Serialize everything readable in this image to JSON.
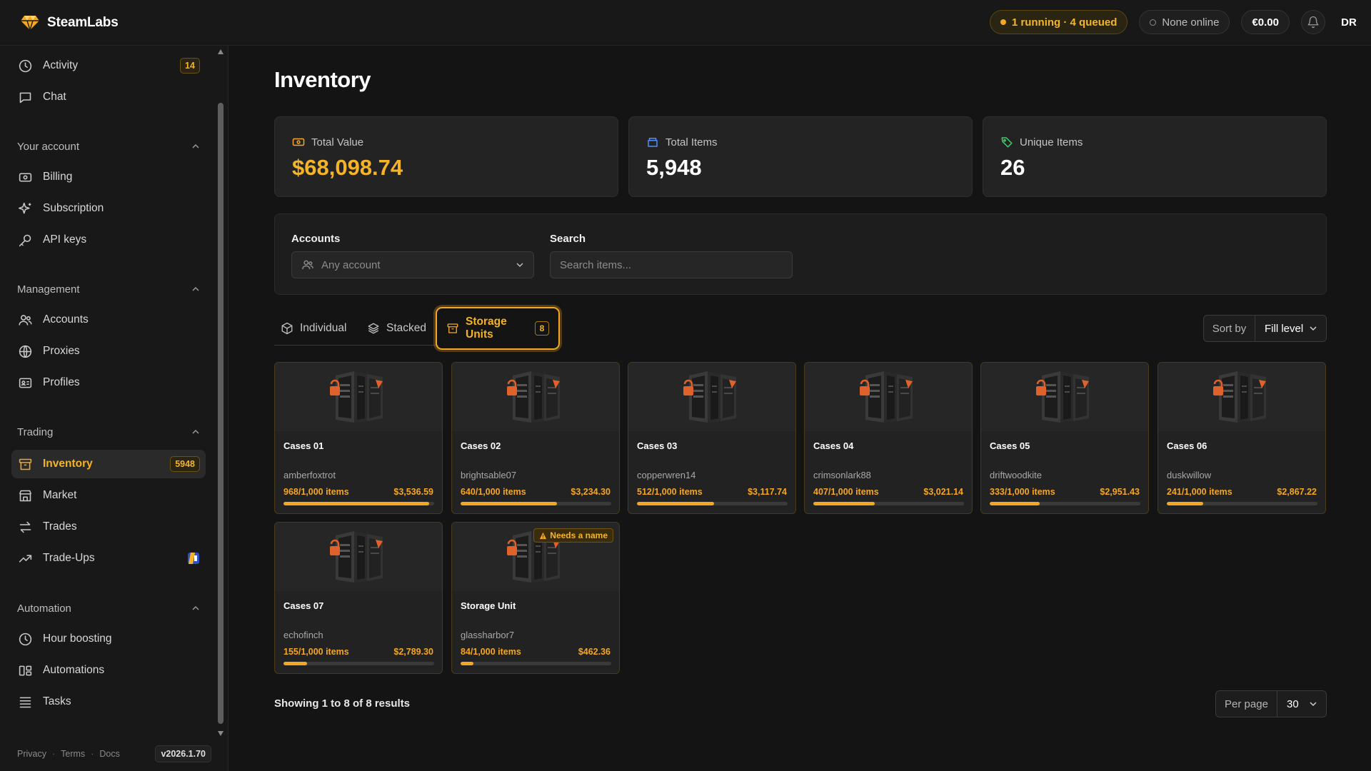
{
  "app": {
    "name": "SteamLabs"
  },
  "topbar": {
    "status": "1 running · 4 queued",
    "online": "None online",
    "balance": "€0.00",
    "avatar": "DR"
  },
  "sidebar": {
    "items": [
      {
        "label": "Activity",
        "icon": "clock-icon",
        "badge": "14"
      },
      {
        "label": "Chat",
        "icon": "chat-icon"
      }
    ],
    "sections": [
      {
        "title": "Your account",
        "items": [
          {
            "label": "Billing",
            "icon": "billing-icon"
          },
          {
            "label": "Subscription",
            "icon": "sparkle-icon"
          },
          {
            "label": "API keys",
            "icon": "key-icon"
          }
        ]
      },
      {
        "title": "Management",
        "items": [
          {
            "label": "Accounts",
            "icon": "users-icon"
          },
          {
            "label": "Proxies",
            "icon": "globe-icon"
          },
          {
            "label": "Profiles",
            "icon": "id-card-icon"
          }
        ]
      },
      {
        "title": "Trading",
        "items": [
          {
            "label": "Inventory",
            "icon": "archive-icon",
            "badge": "5948",
            "active": true
          },
          {
            "label": "Market",
            "icon": "store-icon"
          },
          {
            "label": "Trades",
            "icon": "swap-icon"
          },
          {
            "label": "Trade-Ups",
            "icon": "trend-up-icon"
          }
        ]
      },
      {
        "title": "Automation",
        "items": [
          {
            "label": "Hour boosting",
            "icon": "clock-icon"
          },
          {
            "label": "Automations",
            "icon": "automation-icon"
          },
          {
            "label": "Tasks",
            "icon": "list-icon"
          }
        ]
      }
    ],
    "footer": {
      "privacy": "Privacy",
      "terms": "Terms",
      "docs": "Docs",
      "version": "v2026.1.70"
    }
  },
  "main": {
    "title": "Inventory",
    "stats": {
      "total_value": {
        "label": "Total Value",
        "value": "$68,098.74"
      },
      "total_items": {
        "label": "Total Items",
        "value": "5,948"
      },
      "unique_items": {
        "label": "Unique Items",
        "value": "26"
      }
    },
    "filters": {
      "accounts_label": "Accounts",
      "accounts_value": "Any account",
      "search_label": "Search",
      "search_placeholder": "Search items..."
    },
    "tabs": {
      "individual": "Individual",
      "stacked": "Stacked",
      "storage": "Storage Units",
      "storage_count": "8"
    },
    "sort": {
      "label": "Sort by",
      "value": "Fill level"
    },
    "units": [
      {
        "name": "Cases 01",
        "owner": "amberfoxtrot",
        "fill_text": "968/1,000 items",
        "price": "$3,536.59",
        "fill": 0.968
      },
      {
        "name": "Cases 02",
        "owner": "brightsable07",
        "fill_text": "640/1,000 items",
        "price": "$3,234.30",
        "fill": 0.64
      },
      {
        "name": "Cases 03",
        "owner": "copperwren14",
        "fill_text": "512/1,000 items",
        "price": "$3,117.74",
        "fill": 0.512
      },
      {
        "name": "Cases 04",
        "owner": "crimsonlark88",
        "fill_text": "407/1,000 items",
        "price": "$3,021.14",
        "fill": 0.407
      },
      {
        "name": "Cases 05",
        "owner": "driftwoodkite",
        "fill_text": "333/1,000 items",
        "price": "$2,951.43",
        "fill": 0.333
      },
      {
        "name": "Cases 06",
        "owner": "duskwillow",
        "fill_text": "241/1,000 items",
        "price": "$2,867.22",
        "fill": 0.241
      },
      {
        "name": "Cases 07",
        "owner": "echofinch",
        "fill_text": "155/1,000 items",
        "price": "$2,789.30",
        "fill": 0.155
      },
      {
        "name": "Storage Unit",
        "owner": "glassharbor7",
        "fill_text": "84/1,000 items",
        "price": "$462.36",
        "fill": 0.084,
        "flag": "Needs a name"
      }
    ],
    "results": "Showing 1 to 8 of 8 results",
    "per_page": {
      "label": "Per page",
      "value": "30"
    }
  },
  "colors": {
    "accent": "#f5a623",
    "background": "#141414",
    "panel": "#232323"
  }
}
